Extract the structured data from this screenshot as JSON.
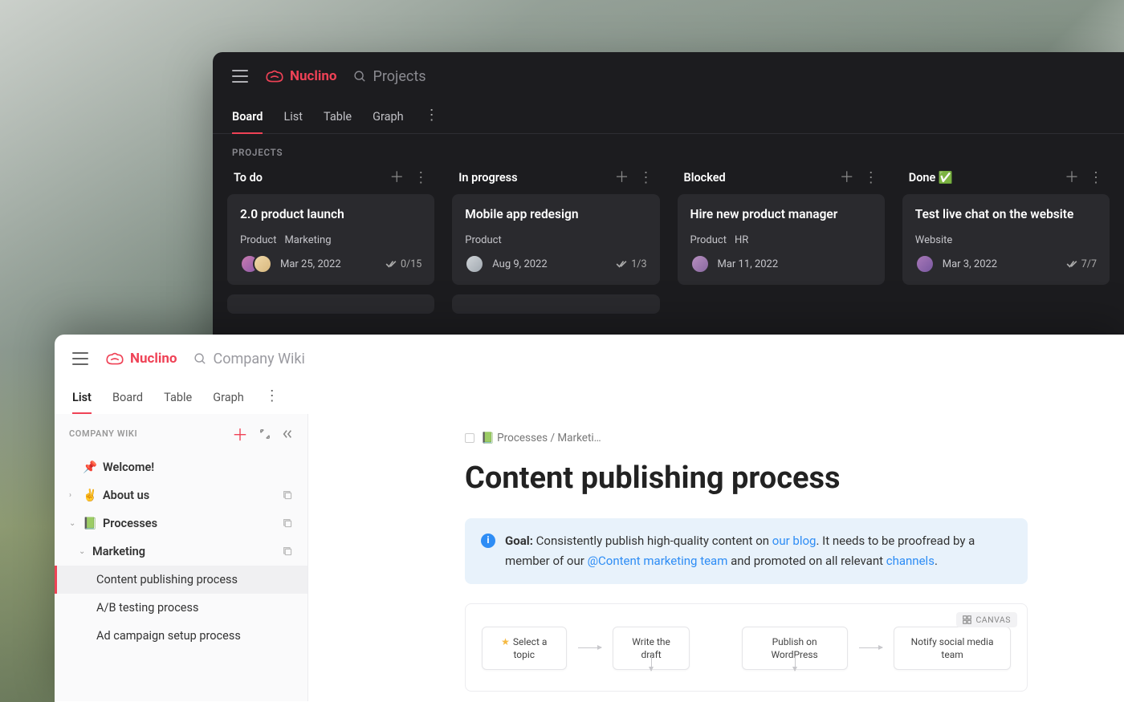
{
  "dark": {
    "brand": "Nuclino",
    "search_placeholder": "Projects",
    "tabs": [
      "Board",
      "List",
      "Table",
      "Graph"
    ],
    "section_label": "PROJECTS",
    "columns": [
      {
        "title": "To do",
        "cards": [
          {
            "title": "2.0 product launch",
            "tags": [
              "Product",
              "Marketing"
            ],
            "avatars": [
              "av1",
              "av2"
            ],
            "date": "Mar 25, 2022",
            "progress": "0/15"
          }
        ]
      },
      {
        "title": "In progress",
        "cards": [
          {
            "title": "Mobile app redesign",
            "tags": [
              "Product"
            ],
            "avatars": [
              "av3"
            ],
            "date": "Aug 9, 2022",
            "progress": "1/3"
          }
        ]
      },
      {
        "title": "Blocked",
        "cards": [
          {
            "title": "Hire new product manager",
            "tags": [
              "Product",
              "HR"
            ],
            "avatars": [
              "av4"
            ],
            "date": "Mar 11, 2022",
            "progress": ""
          }
        ]
      },
      {
        "title": "Done ✅",
        "cards": [
          {
            "title": "Test live chat on the website",
            "tags": [
              "Website"
            ],
            "avatars": [
              "av5"
            ],
            "date": "Mar 3, 2022",
            "progress": "7/7"
          }
        ]
      }
    ]
  },
  "light": {
    "brand": "Nuclino",
    "search_placeholder": "Company Wiki",
    "tabs": [
      "List",
      "Board",
      "Table",
      "Graph"
    ],
    "side_title": "COMPANY WIKI",
    "tree": {
      "welcome": "Welcome!",
      "about": "About us",
      "processes": "Processes",
      "marketing": "Marketing",
      "items": [
        "Content publishing process",
        "A/B testing process",
        "Ad campaign setup process"
      ]
    },
    "breadcrumb": "📗 Processes / Marketi…",
    "doc_title": "Content publishing process",
    "callout": {
      "goal_label": "Goal:",
      "text1": " Consistently publish high-quality content on ",
      "link1": "our blog",
      "text2": ". It needs to be proofread by a member of our ",
      "link2": "@Content marketing team",
      "text3": " and promoted on all relevant ",
      "link3": "channels",
      "text4": "."
    },
    "canvas_label": "CANVAS",
    "flow": [
      "Select a topic",
      "Write the draft",
      "Publish on WordPress",
      "Notify social media team"
    ]
  }
}
